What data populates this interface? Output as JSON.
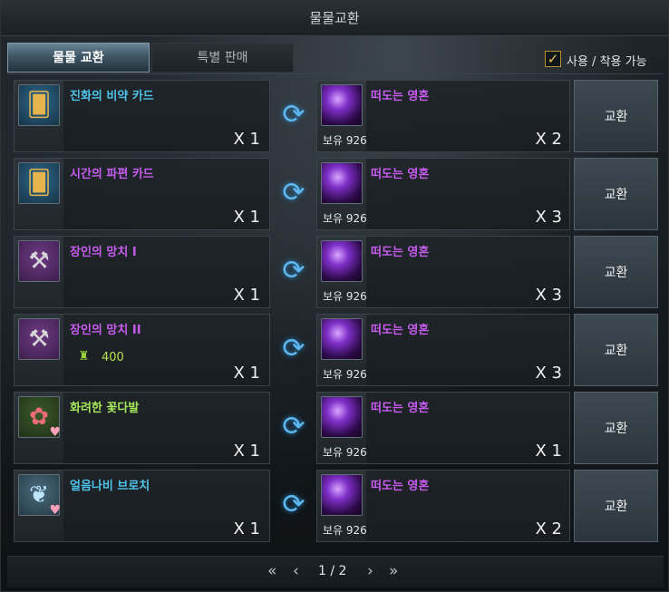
{
  "window": {
    "title": "물물교환"
  },
  "tabs": [
    {
      "label": "물물 교환",
      "active": true
    },
    {
      "label": "특별 판매",
      "active": false
    }
  ],
  "filter": {
    "label": "사용 / 착용 가능",
    "checked": true,
    "check_glyph": "✓"
  },
  "colors": {
    "cyan_name": "#4fc4ea",
    "purple_name": "#c85cf0",
    "green_name": "#a6e85a",
    "accent_blue": "#5fb8f0"
  },
  "rows": [
    {
      "give": {
        "name": "진화의 비약 카드",
        "name_color": "#4fc4ea",
        "icon": "card-icon",
        "glyph": "🂠",
        "qty": "X 1"
      },
      "get": {
        "name": "떠도는 영혼",
        "owned": "보유 926",
        "qty": "X 2"
      },
      "button": "교환"
    },
    {
      "give": {
        "name": "시간의 파편 카드",
        "name_color": "#c85cf0",
        "icon": "card-icon",
        "glyph": "🂠",
        "qty": "X 1"
      },
      "get": {
        "name": "떠도는 영혼",
        "owned": "보유 926",
        "qty": "X 3"
      },
      "button": "교환"
    },
    {
      "give": {
        "name": "장인의 망치 I",
        "name_color": "#c85cf0",
        "icon": "hammer-icon",
        "glyph": "⚒",
        "qty": "X 1"
      },
      "get": {
        "name": "떠도는 영혼",
        "owned": "보유 926",
        "qty": "X 3"
      },
      "button": "교환"
    },
    {
      "give": {
        "name": "장인의 망치 II",
        "name_color": "#c85cf0",
        "icon": "hammer-icon",
        "glyph": "⚒",
        "qty": "X 1",
        "sub_value": "400"
      },
      "get": {
        "name": "떠도는 영혼",
        "owned": "보유 926",
        "qty": "X 3"
      },
      "button": "교환"
    },
    {
      "give": {
        "name": "화려한 꽃다발",
        "name_color": "#a6e85a",
        "icon": "flower-bouquet-icon",
        "glyph": "✿",
        "qty": "X 1",
        "heart": true
      },
      "get": {
        "name": "떠도는 영혼",
        "owned": "보유 926",
        "qty": "X 1"
      },
      "button": "교환"
    },
    {
      "give": {
        "name": "얼음나비 브로치",
        "name_color": "#4fc4ea",
        "icon": "butterfly-brooch-icon",
        "glyph": "❦",
        "qty": "X 1",
        "heart": true
      },
      "get": {
        "name": "떠도는 영혼",
        "owned": "보유 926",
        "qty": "X 2"
      },
      "button": "교환"
    }
  ],
  "pager": {
    "text": "1 / 2",
    "current": 1,
    "total": 2
  }
}
